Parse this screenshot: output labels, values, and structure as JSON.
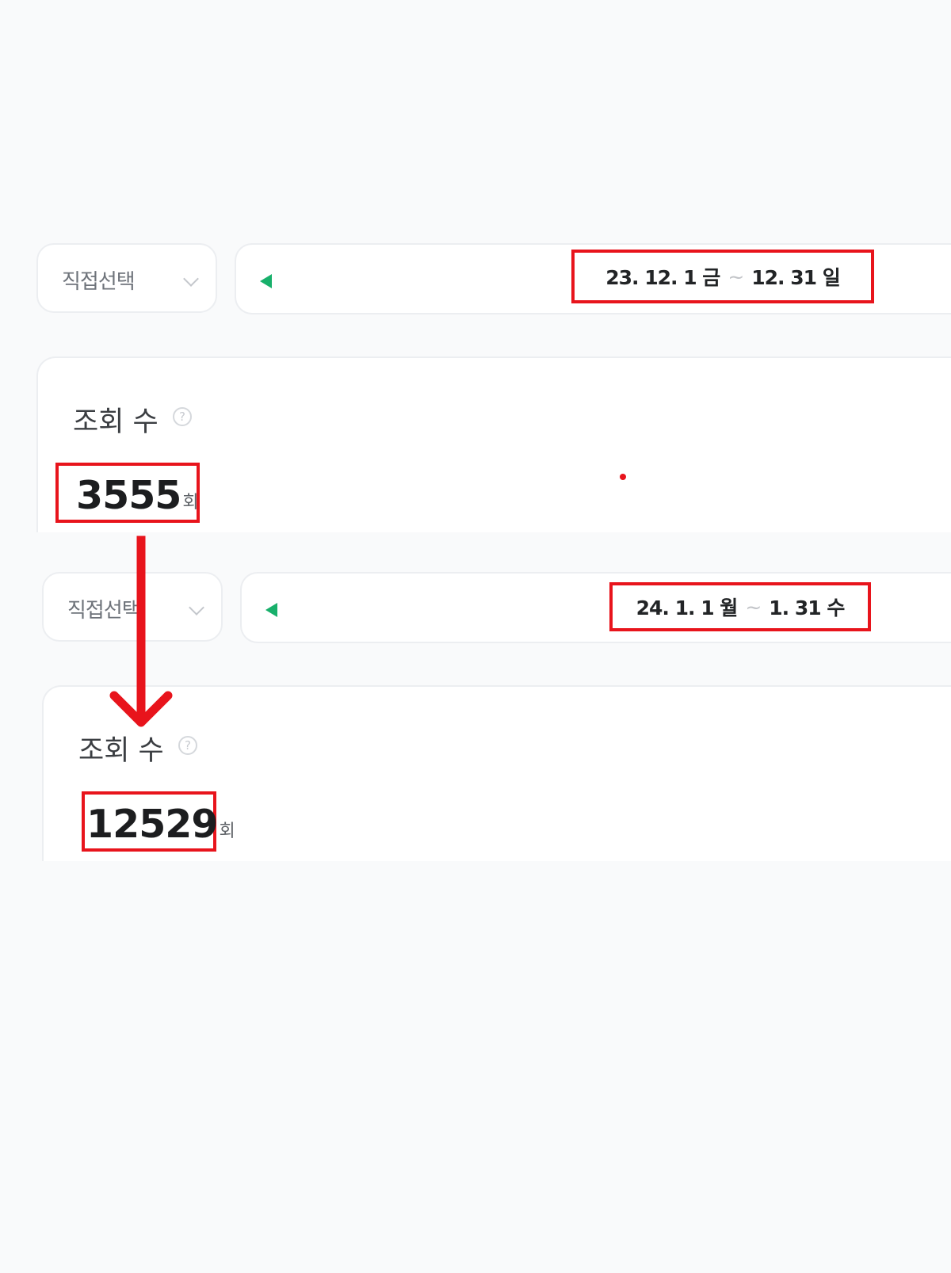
{
  "before": {
    "period_selector": "직접선택",
    "date_range": {
      "start": "23. 12. 1 금",
      "separator": "~",
      "end": "12. 31 일"
    },
    "metric": {
      "label": "조회 수",
      "help": "?",
      "value": "3555",
      "unit": "회"
    }
  },
  "after": {
    "period_selector": "직접선택",
    "date_range": {
      "start": "24. 1. 1 월",
      "separator": "~",
      "end": "1. 31 수"
    },
    "metric": {
      "label": "조회 수",
      "help": "?",
      "value": "12529",
      "unit": "회"
    }
  },
  "colors": {
    "highlight": "#e8141c",
    "accent_green": "#18b06b",
    "card": "#ffffff",
    "background": "#f9fafb"
  }
}
